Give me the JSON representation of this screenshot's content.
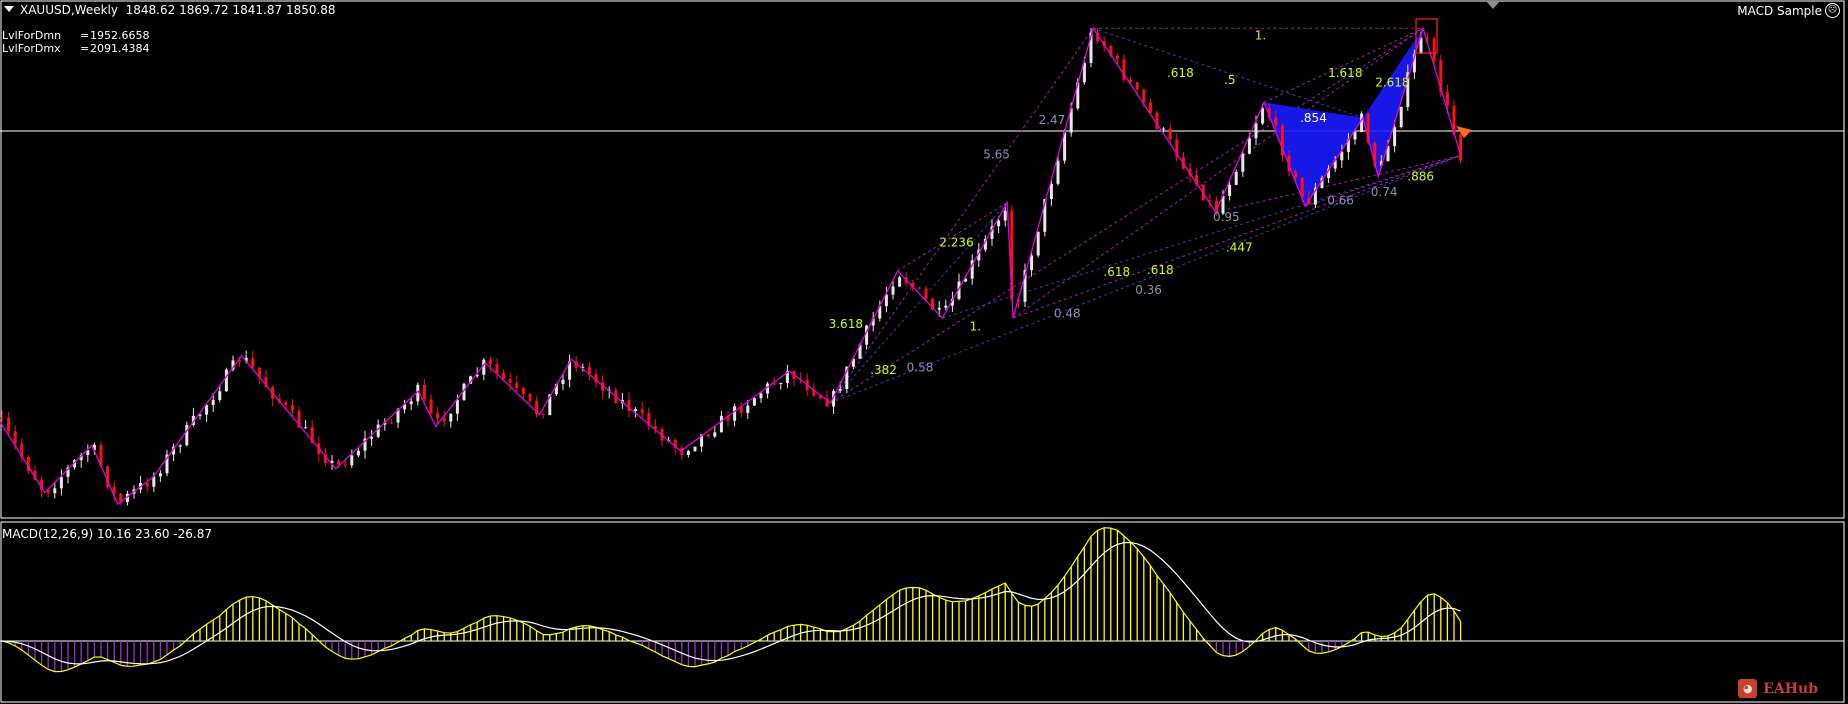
{
  "header": {
    "symbol_tf": "XAUUSD,Weekly",
    "ohlc": "1848.62 1869.72 1841.87 1850.88"
  },
  "levels": [
    {
      "name": "LvlForDmn",
      "eq": "=",
      "value": "1952.6658"
    },
    {
      "name": "LvlForDmx",
      "eq": "=",
      "value": "2091.4384"
    }
  ],
  "expert": {
    "name": "MACD Sample",
    "status_icon": "frown-face-icon"
  },
  "macd": {
    "label": "MACD(12,26,9) 10.16 23.60 -26.87"
  },
  "watermark": {
    "text": "EAHub"
  },
  "colors": {
    "bull": "#e8e8e8",
    "bear": "#ff1010",
    "zigzag": "#e000e0",
    "fib": "#c8ff00",
    "ratio": "#8c8cb4",
    "pattern": "#1a1aff",
    "signal": "#ffff00",
    "macd_main": "#ffffff",
    "hist_pos": "#ffff00",
    "hist_neg": "#9933cc"
  },
  "fib_labels": [
    {
      "t": "1.",
      "c": "gold"
    },
    {
      "t": ".618",
      "c": "fib"
    },
    {
      "t": ".5",
      "c": "fib"
    },
    {
      "t": "1.618",
      "c": "fib"
    },
    {
      "t": "2.618",
      "c": "fib"
    },
    {
      "t": ".854",
      "c": "white"
    },
    {
      "t": "2.47",
      "c": "ratio"
    },
    {
      "t": "5.65",
      "c": "ratio"
    },
    {
      "t": "0.95",
      "c": "ratio"
    },
    {
      "t": "0.66",
      "c": "ratio"
    },
    {
      "t": "0.74",
      "c": "ratio"
    },
    {
      "t": ".886",
      "c": "fib"
    },
    {
      "t": ".447",
      "c": "fib"
    },
    {
      "t": "2.236",
      "c": "fib"
    },
    {
      "t": ".618",
      "c": "fib"
    },
    {
      "t": ".618",
      "c": "fib"
    },
    {
      "t": "0.36",
      "c": "ratio"
    },
    {
      "t": "0.48",
      "c": "ratio"
    },
    {
      "t": "3.618",
      "c": "fib"
    },
    {
      "t": "1.",
      "c": "fib"
    },
    {
      "t": ".382",
      "c": "fib"
    },
    {
      "t": "0.58",
      "c": "ratio"
    }
  ]
}
